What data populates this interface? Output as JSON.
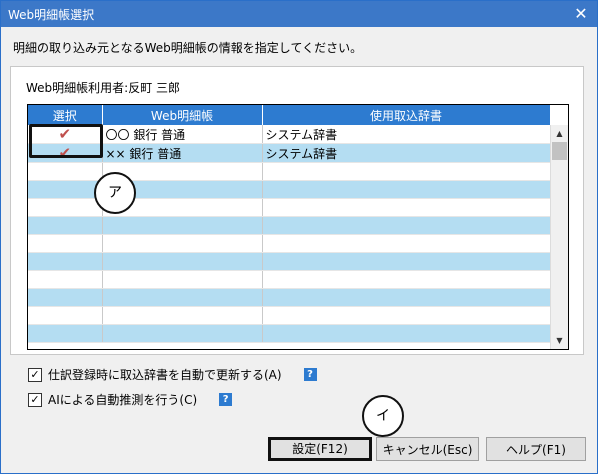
{
  "window": {
    "title": "Web明細帳選択",
    "close_glyph": "✕"
  },
  "instruction": "明細の取り込み元となるWeb明細帳の情報を指定してください。",
  "user": {
    "label": "Web明細帳利用者:反町 三郎"
  },
  "grid": {
    "columns": [
      "選択",
      "Web明細帳",
      "使用取込辞書"
    ],
    "rows": [
      {
        "selected": true,
        "check": "✔",
        "account": "〇〇 銀行 普通",
        "dictionary": "システム辞書"
      },
      {
        "selected": true,
        "check": "✔",
        "account": "×× 銀行 普通",
        "dictionary": "システム辞書"
      }
    ]
  },
  "callouts": {
    "a": "ア",
    "i": "イ"
  },
  "options": [
    {
      "label": "仕訳登録時に取込辞書を自動で更新する(A)",
      "checked": true,
      "mark": "✓",
      "help": "?"
    },
    {
      "label": "AIによる自動推測を行う(C)",
      "checked": true,
      "mark": "✓",
      "help": "?"
    }
  ],
  "buttons": {
    "settings": "設定(F12)",
    "cancel": "キャンセル(Esc)",
    "help": "ヘルプ(F1)"
  },
  "colors": {
    "titlebar": "#3c78c8",
    "header": "#2d7bd0",
    "alt_row": "#b4ddf2",
    "check": "#c0504d"
  }
}
